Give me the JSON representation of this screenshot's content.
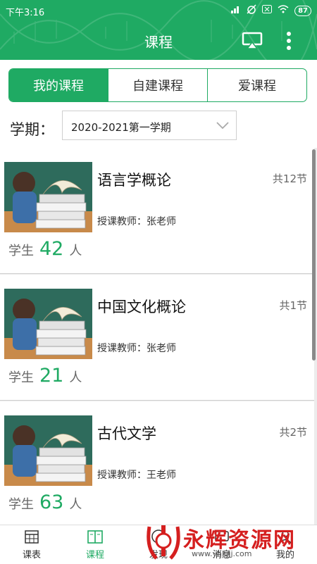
{
  "status": {
    "time": "下午3:16",
    "battery": "87"
  },
  "header": {
    "title": "课程",
    "cast_icon": "cast-icon",
    "more_icon": "more-vert-icon"
  },
  "tabs": [
    {
      "label": "我的课程",
      "active": true
    },
    {
      "label": "自建课程",
      "active": false
    },
    {
      "label": "爱课程",
      "active": false
    }
  ],
  "term": {
    "label": "学期：",
    "value": "2020-2021第一学期"
  },
  "courses": [
    {
      "name": "语言学概论",
      "count": "共12节",
      "teacher": "授课教师：张老师",
      "students_label": "学生",
      "students": "42",
      "unit": "人"
    },
    {
      "name": "中国文化概论",
      "count": "共1节",
      "teacher": "授课教师：张老师",
      "students_label": "学生",
      "students": "21",
      "unit": "人"
    },
    {
      "name": "古代文学",
      "count": "共2节",
      "teacher": "授课教师：王老师",
      "students_label": "学生",
      "students": "63",
      "unit": "人"
    }
  ],
  "bottom_nav": [
    {
      "label": "课表",
      "icon": "calendar-icon",
      "active": false
    },
    {
      "label": "课程",
      "icon": "book-icon",
      "active": true
    },
    {
      "label": "发现",
      "icon": "compass-icon",
      "active": false
    },
    {
      "label": "消息",
      "icon": "message-icon",
      "active": false
    },
    {
      "label": "我的",
      "icon": "user-icon",
      "active": false
    }
  ],
  "watermark": {
    "text": "永辉资源网",
    "url": "www.yhkjjj.com"
  },
  "colors": {
    "primary": "#1faa63"
  }
}
